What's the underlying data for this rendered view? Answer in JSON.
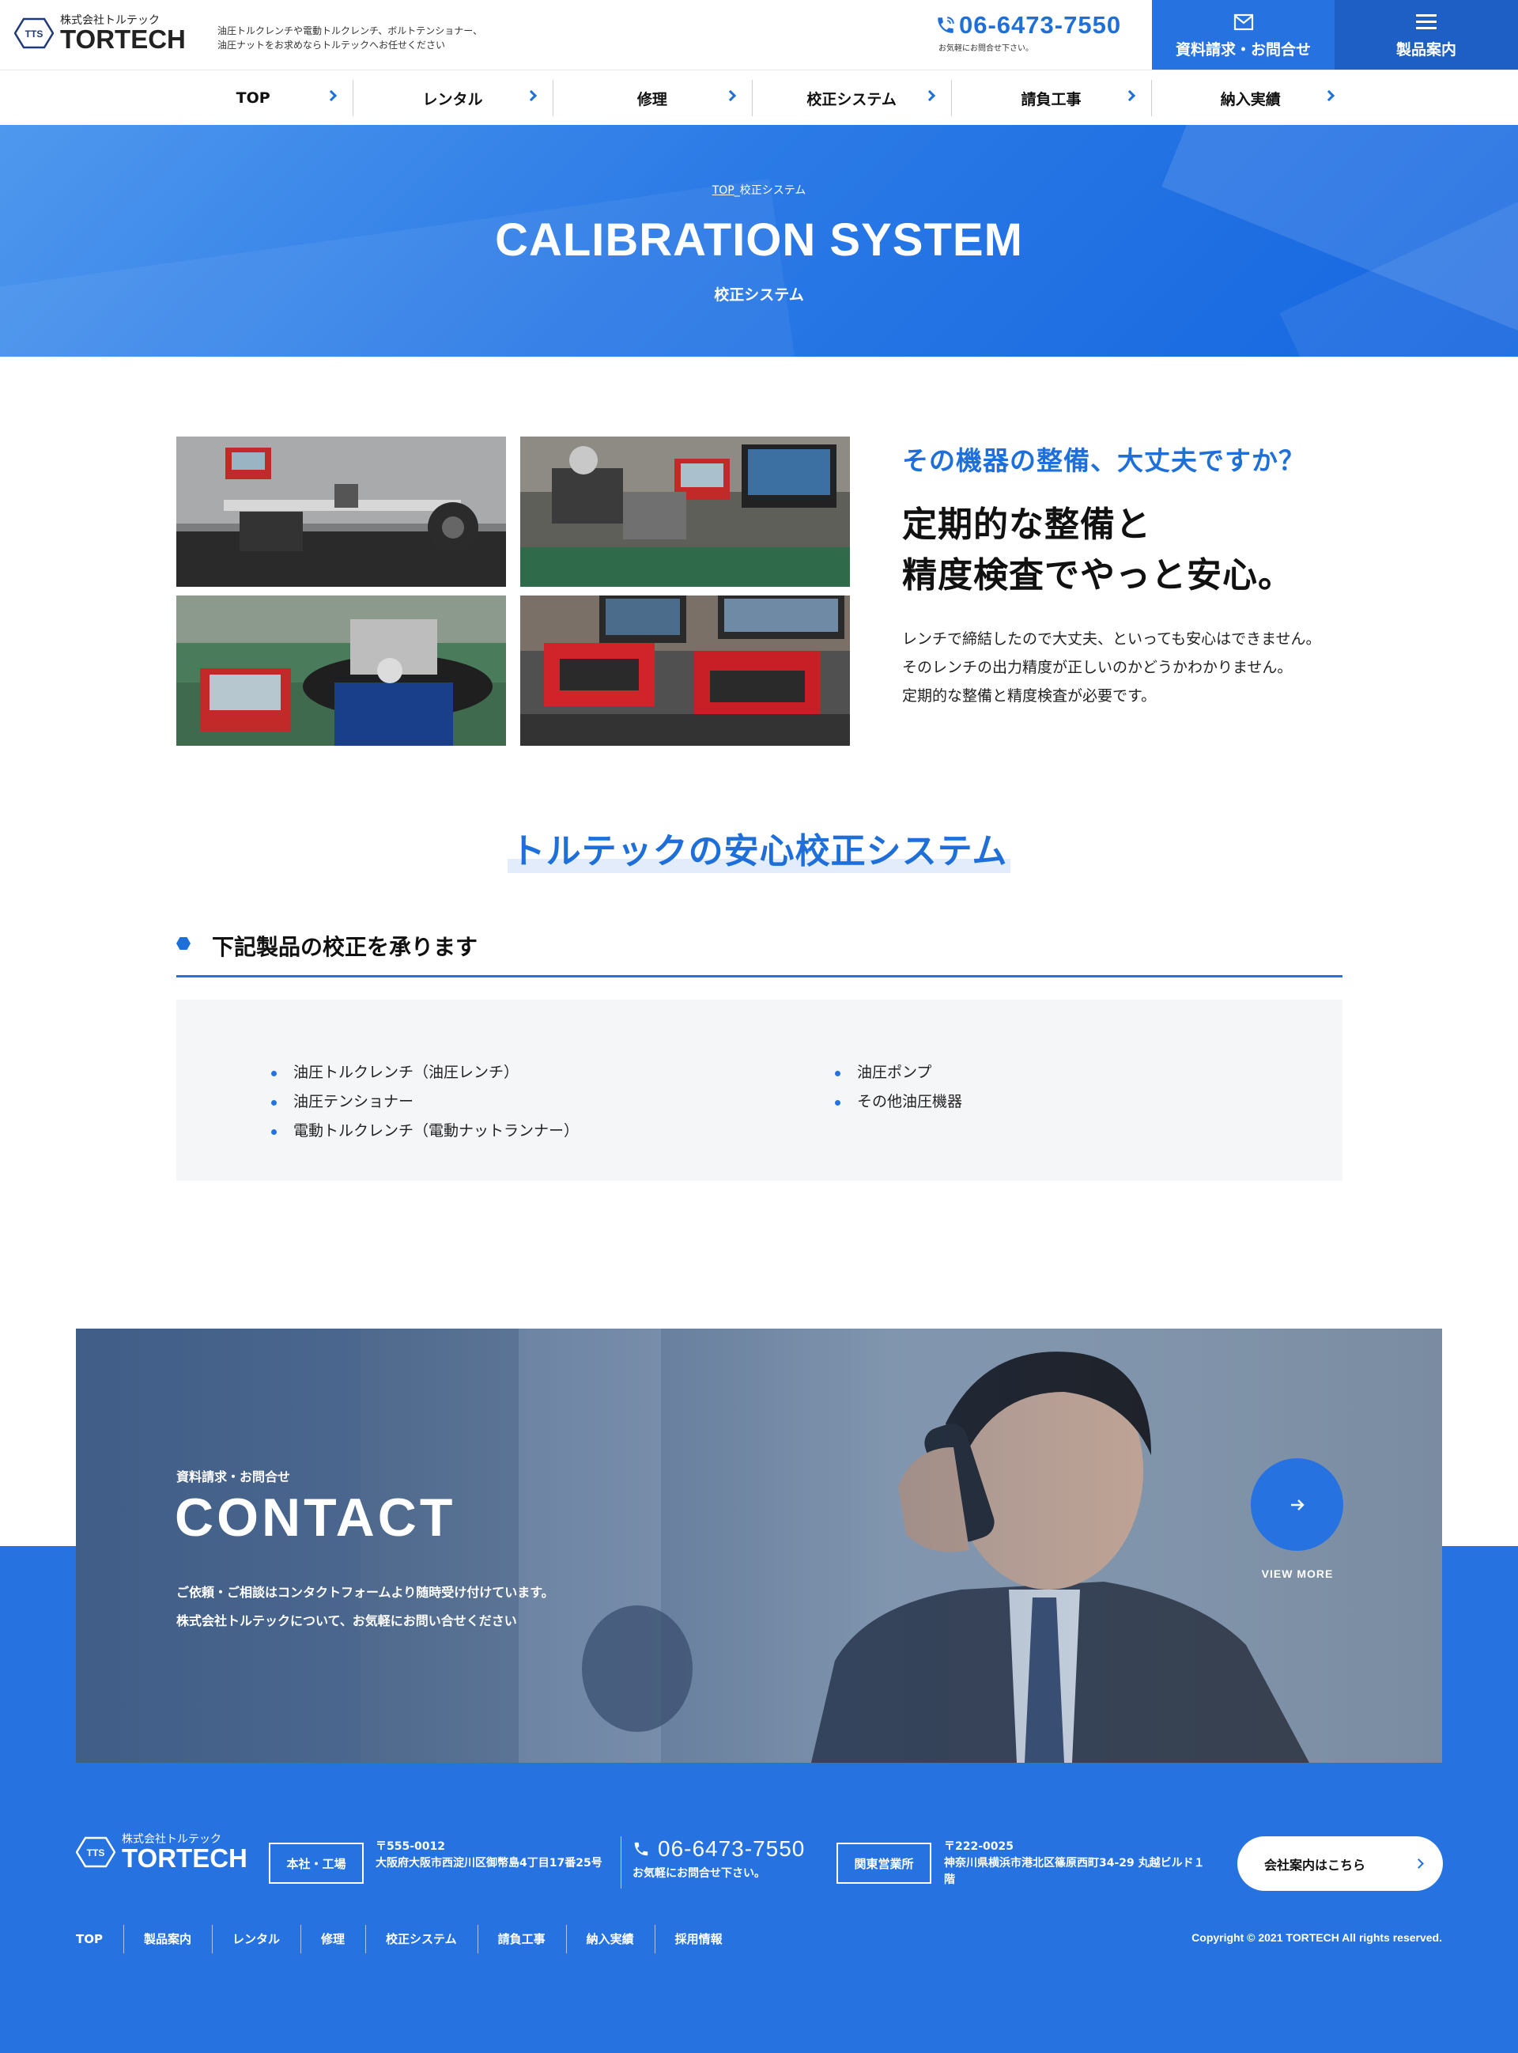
{
  "header": {
    "logo_sub": "株式会社トルテック",
    "logo_main": "TORTECH",
    "logo_mark": "TTS",
    "tagline_1": "油圧トルクレンチや電動トルクレンチ、ボルトテンショナー、",
    "tagline_2": "油圧ナットをお求めならトルテックへお任せください",
    "phone": "06-6473-7550",
    "phone_note": "お気軽にお問合せ下さい。",
    "contact_button": "資料請求・お問合せ",
    "products_button": "製品案内"
  },
  "nav": {
    "items": [
      {
        "label": "TOP"
      },
      {
        "label": "レンタル"
      },
      {
        "label": "修理"
      },
      {
        "label": "校正システム"
      },
      {
        "label": "請負工事"
      },
      {
        "label": "納入実績"
      }
    ]
  },
  "hero": {
    "breadcrumb_top": "TOP",
    "breadcrumb_sep": "_",
    "breadcrumb_current": "校正システム",
    "title": "CALIBRATION SYSTEM",
    "subtitle": "校正システム"
  },
  "intro": {
    "lead": "その機器の整備、大丈夫ですか？",
    "heading_1": "定期的な整備と",
    "heading_2": "精度検査でやっと安心。",
    "body_1": "レンチで締結したので大丈夫、といっても安心はできません。",
    "body_2": "そのレンチの出力精度が正しいのかどうかわかりません。",
    "body_3": "定期的な整備と精度検査が必要です。"
  },
  "section": {
    "title": "トルテックの安心校正システム",
    "subheading": "下記製品の校正を承ります",
    "list_left": [
      "油圧トルクレンチ（油圧レンチ）",
      "油圧テンショナー",
      "電動トルクレンチ（電動ナットランナー）"
    ],
    "list_right": [
      "油圧ポンプ",
      "その他油圧機器"
    ]
  },
  "contact": {
    "label": "資料請求・お問合せ",
    "title": "CONTACT",
    "desc_1": "ご依頼・ご相談はコンタクトフォームより随時受け付けています。",
    "desc_2": "株式会社トルテックについて、お気軽にお問い合せください",
    "view_more": "VIEW MORE"
  },
  "footer": {
    "logo_sub": "株式会社トルテック",
    "logo_main": "TORTECH",
    "logo_mark": "TTS",
    "office1_tag": "本社・工場",
    "office1_zip": "〒555-0012",
    "office1_addr": "大阪府大阪市西淀川区御幣島4丁目17番25号",
    "phone": "06-6473-7550",
    "phone_note": "お気軽にお問合せ下さい。",
    "office2_tag": "関東営業所",
    "office2_zip": "〒222-0025",
    "office2_addr": "神奈川県横浜市港北区篠原西町34-29 丸越ビルド１階",
    "company_button": "会社案内はこちら",
    "nav": [
      "TOP",
      "製品案内",
      "レンタル",
      "修理",
      "校正システム",
      "請負工事",
      "納入実績",
      "採用情報"
    ],
    "copyright": "Copyright © 2021 TORTECH All rights reserved."
  },
  "colors": {
    "accent": "#1e6fd9",
    "accent_dark": "#1d5fc4",
    "footer_bg": "#2572e0"
  }
}
